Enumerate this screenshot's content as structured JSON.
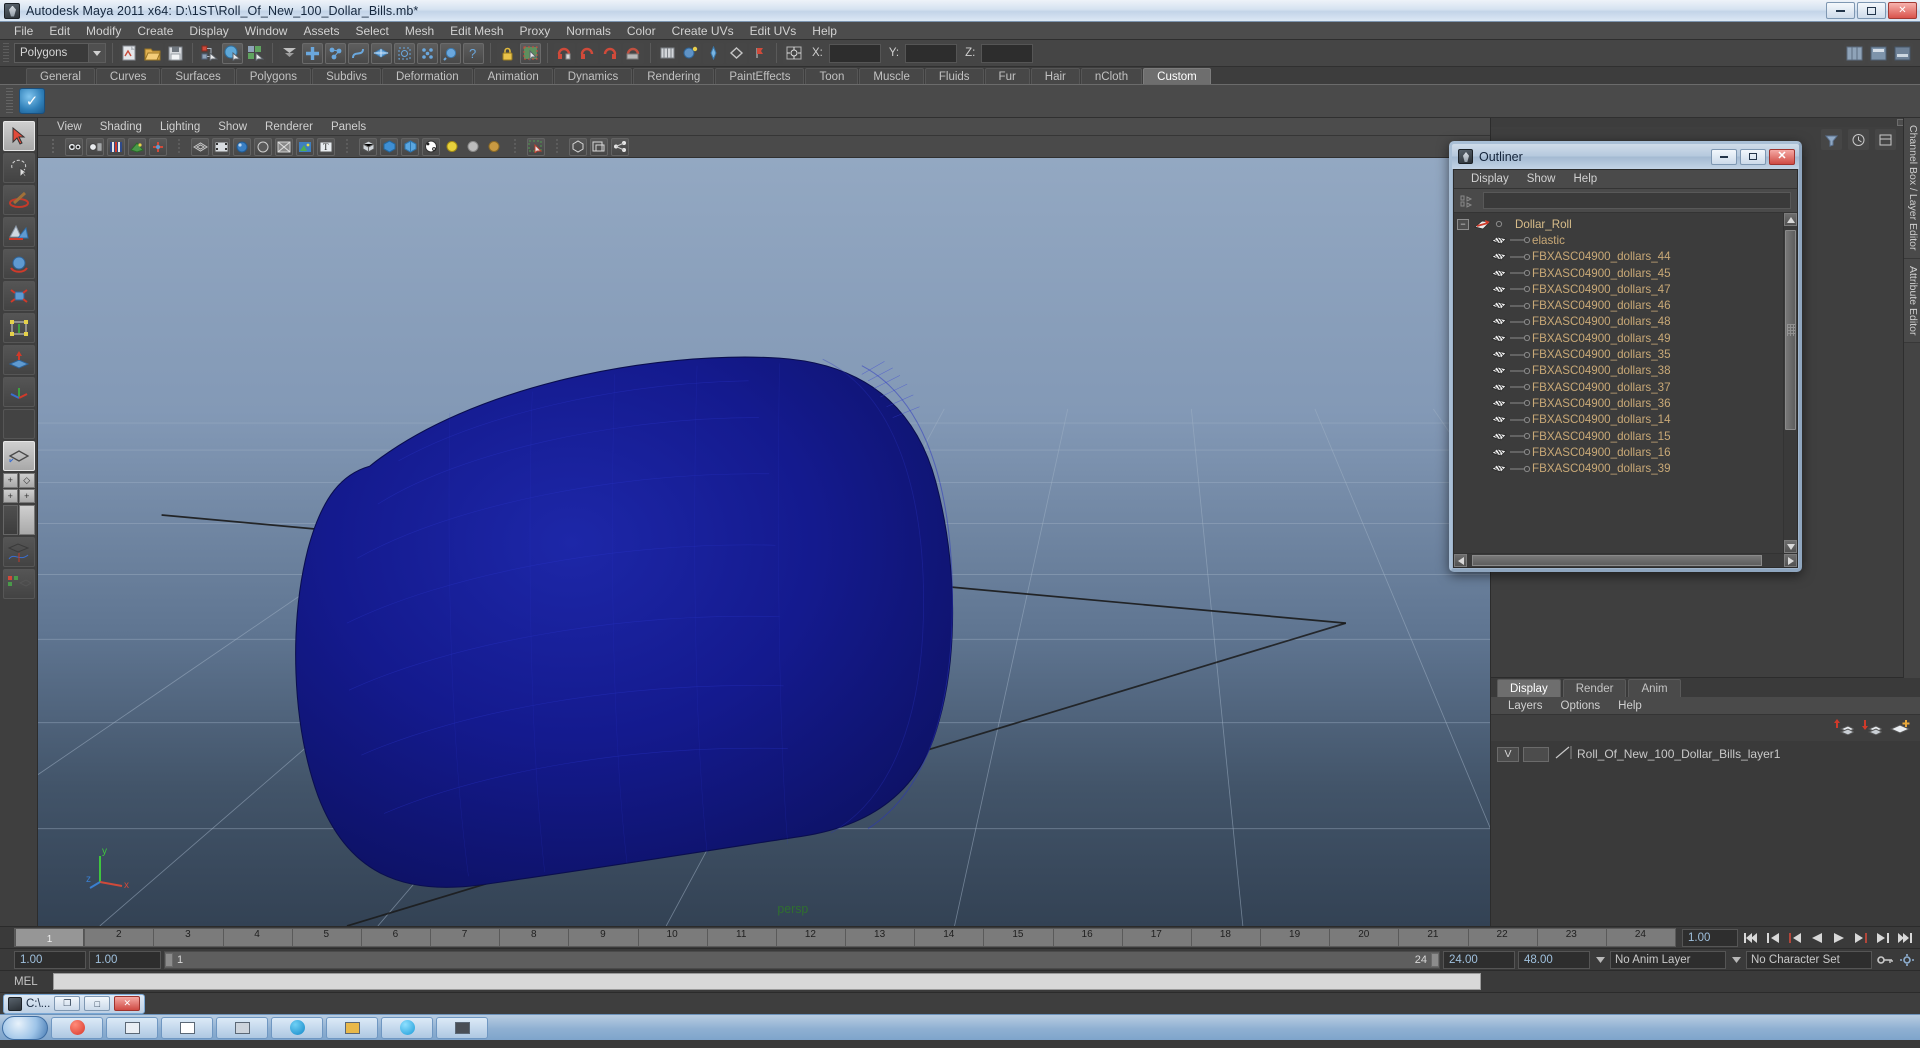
{
  "window": {
    "title": "Autodesk Maya 2011 x64: D:\\1ST\\Roll_Of_New_100_Dollar_Bills.mb*",
    "icon": "maya-icon",
    "minimize": "–",
    "maximize": "□",
    "close": "✕"
  },
  "menubar": {
    "items": [
      "File",
      "Edit",
      "Modify",
      "Create",
      "Display",
      "Window",
      "Assets",
      "Select",
      "Mesh",
      "Edit Mesh",
      "Proxy",
      "Normals",
      "Color",
      "Create UVs",
      "Edit UVs",
      "Help"
    ]
  },
  "statusline": {
    "mode_selector": "Polygons",
    "coords": {
      "x_label": "X:",
      "y_label": "Y:",
      "z_label": "Z:",
      "x_value": "",
      "y_value": "",
      "z_value": ""
    }
  },
  "shelf": {
    "tabs": [
      "General",
      "Curves",
      "Surfaces",
      "Polygons",
      "Subdivs",
      "Deformation",
      "Animation",
      "Dynamics",
      "Rendering",
      "PaintEffects",
      "Toon",
      "Muscle",
      "Fluids",
      "Fur",
      "Hair",
      "nCloth",
      "Custom"
    ],
    "active_tab": "Custom"
  },
  "panel": {
    "menu": [
      "View",
      "Shading",
      "Lighting",
      "Show",
      "Renderer",
      "Panels"
    ],
    "viewport_label": "persp"
  },
  "axis_gnomon": {
    "y": "y",
    "x": "x",
    "z": "z"
  },
  "outliner": {
    "title": "Outliner",
    "menu": [
      "Display",
      "Show",
      "Help"
    ],
    "search_value": "",
    "items": [
      {
        "name": "Dollar_Roll",
        "depth": 0,
        "expander": "−",
        "icon": "transform-icon"
      },
      {
        "name": "elastic",
        "depth": 1,
        "expander": "",
        "icon": "mesh-icon"
      },
      {
        "name": "FBXASC04900_dollars_44",
        "depth": 1,
        "expander": "",
        "icon": "mesh-icon"
      },
      {
        "name": "FBXASC04900_dollars_45",
        "depth": 1,
        "expander": "",
        "icon": "mesh-icon"
      },
      {
        "name": "FBXASC04900_dollars_47",
        "depth": 1,
        "expander": "",
        "icon": "mesh-icon"
      },
      {
        "name": "FBXASC04900_dollars_46",
        "depth": 1,
        "expander": "",
        "icon": "mesh-icon"
      },
      {
        "name": "FBXASC04900_dollars_48",
        "depth": 1,
        "expander": "",
        "icon": "mesh-icon"
      },
      {
        "name": "FBXASC04900_dollars_49",
        "depth": 1,
        "expander": "",
        "icon": "mesh-icon"
      },
      {
        "name": "FBXASC04900_dollars_35",
        "depth": 1,
        "expander": "",
        "icon": "mesh-icon"
      },
      {
        "name": "FBXASC04900_dollars_38",
        "depth": 1,
        "expander": "",
        "icon": "mesh-icon"
      },
      {
        "name": "FBXASC04900_dollars_37",
        "depth": 1,
        "expander": "",
        "icon": "mesh-icon"
      },
      {
        "name": "FBXASC04900_dollars_36",
        "depth": 1,
        "expander": "",
        "icon": "mesh-icon"
      },
      {
        "name": "FBXASC04900_dollars_14",
        "depth": 1,
        "expander": "",
        "icon": "mesh-icon"
      },
      {
        "name": "FBXASC04900_dollars_15",
        "depth": 1,
        "expander": "",
        "icon": "mesh-icon"
      },
      {
        "name": "FBXASC04900_dollars_16",
        "depth": 1,
        "expander": "",
        "icon": "mesh-icon"
      },
      {
        "name": "FBXASC04900_dollars_39",
        "depth": 1,
        "expander": "",
        "icon": "mesh-icon"
      }
    ]
  },
  "layer_editor": {
    "tabs": [
      "Display",
      "Render",
      "Anim"
    ],
    "active_tab": "Display",
    "menu": [
      "Layers",
      "Options",
      "Help"
    ],
    "layers": [
      {
        "visibility": "V",
        "playback": "",
        "name": "Roll_Of_New_100_Dollar_Bills_layer1"
      }
    ]
  },
  "right_vertical_tabs": [
    "Channel Box / Layer Editor",
    "Attribute Editor"
  ],
  "timeline": {
    "start": 1,
    "end": 24,
    "current_frame": "1",
    "tick_labels": [
      "1",
      "2",
      "3",
      "4",
      "5",
      "6",
      "7",
      "8",
      "9",
      "10",
      "11",
      "12",
      "13",
      "14",
      "15",
      "16",
      "17",
      "18",
      "19",
      "20",
      "21",
      "22",
      "23",
      "24"
    ],
    "playback_speed": "1.00",
    "transport": [
      "go-to-start-icon",
      "step-back-keyframe-icon",
      "step-back-frame-icon",
      "play-backwards-icon",
      "play-forwards-icon",
      "step-forward-frame-icon",
      "step-forward-keyframe-icon",
      "go-to-end-icon"
    ]
  },
  "range_bar": {
    "anim_start": "1.00",
    "range_start": "1.00",
    "slider_min": "1",
    "slider_max": "24",
    "range_end": "24.00",
    "anim_end": "48.00",
    "anim_layer": "No Anim Layer",
    "character_set": "No Character Set"
  },
  "mel": {
    "label": "MEL",
    "value": ""
  },
  "taskbar": {
    "child_window": {
      "label": "C:\\...",
      "restore": "❐",
      "maximize": "□",
      "close": "✕"
    }
  }
}
